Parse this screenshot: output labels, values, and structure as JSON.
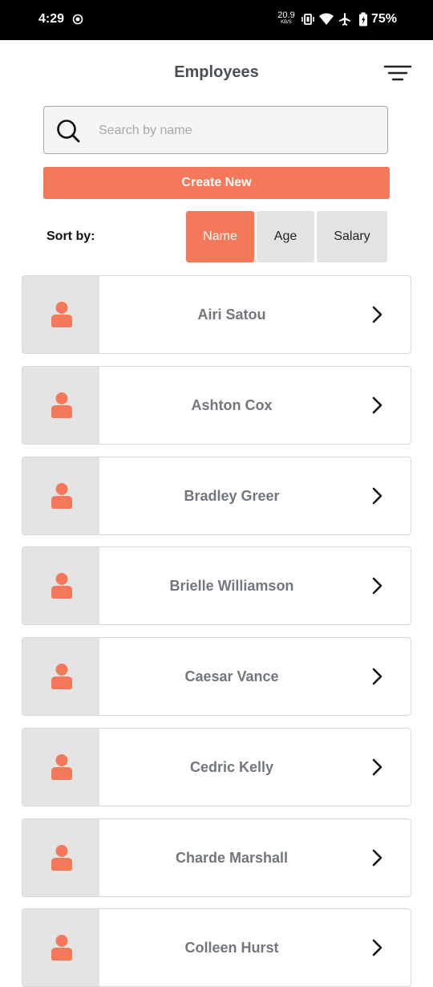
{
  "status_bar": {
    "time": "4:29",
    "net_speed": "20.9",
    "net_unit": "KB/S",
    "battery": "75%"
  },
  "header": {
    "title": "Employees",
    "filter_icon": "filter-lines-icon"
  },
  "search": {
    "placeholder": "Search by name",
    "value": ""
  },
  "create_button_label": "Create New",
  "sort": {
    "label": "Sort by:",
    "options": [
      "Name",
      "Age",
      "Salary"
    ],
    "selected": "Name"
  },
  "employees": [
    {
      "name": "Airi Satou"
    },
    {
      "name": "Ashton Cox"
    },
    {
      "name": "Bradley Greer"
    },
    {
      "name": "Brielle Williamson"
    },
    {
      "name": "Caesar Vance"
    },
    {
      "name": "Cedric Kelly"
    },
    {
      "name": "Charde Marshall"
    },
    {
      "name": "Colleen Hurst"
    }
  ],
  "colors": {
    "accent": "#f4785a",
    "avatar_bg": "#e4e4e4",
    "name_text": "#72767d"
  }
}
